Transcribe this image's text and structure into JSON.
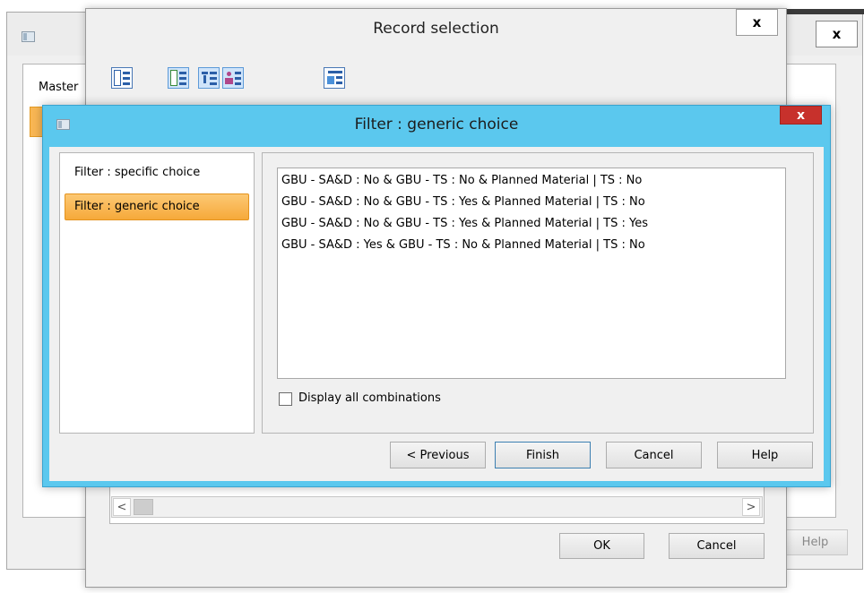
{
  "master_window": {
    "title": "",
    "close_label": "x",
    "tab_label": "Master",
    "help_label": "Help"
  },
  "record_window": {
    "title": "Record selection",
    "close_label": "x",
    "toolbar_icons": [
      "list-view-icon",
      "checklist-icon",
      "filter-list-icon",
      "user-list-icon",
      "group-tree-icon"
    ],
    "scroll_left": "<",
    "scroll_right": ">",
    "ok_label": "OK",
    "cancel_label": "Cancel"
  },
  "filter_dialog": {
    "title": "Filter : generic choice",
    "close_label": "x",
    "nav_items": [
      {
        "label": "Filter : specific choice",
        "selected": false
      },
      {
        "label": "Filter : generic choice",
        "selected": true
      }
    ],
    "combinations": [
      "GBU - SA&D :  No & GBU - TS :  No & Planned Material | TS :  No",
      "GBU - SA&D :  No & GBU - TS :  Yes & Planned Material | TS :  No",
      "GBU - SA&D :  No & GBU - TS :  Yes & Planned Material | TS :  Yes",
      "GBU - SA&D :  Yes & GBU - TS :  No & Planned Material | TS :  No"
    ],
    "display_all_label": "Display all combinations",
    "display_all_checked": false,
    "previous_label": "< Previous",
    "finish_label": "Finish",
    "cancel_label": "Cancel",
    "help_label": "Help"
  },
  "colors": {
    "titlebar_active": "#5bc8ee",
    "close_red": "#c7312c",
    "selected_orange": "#f9b754"
  }
}
